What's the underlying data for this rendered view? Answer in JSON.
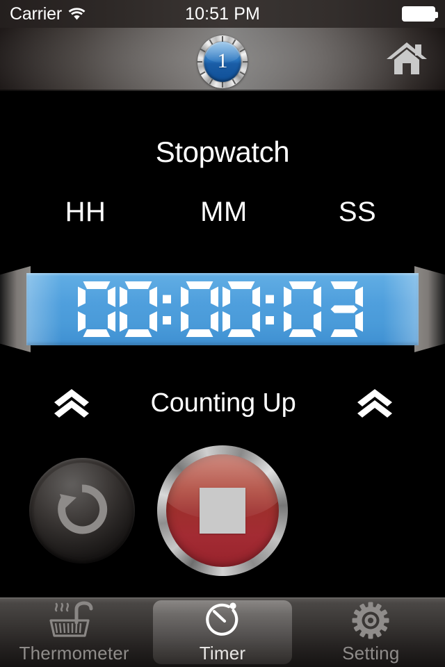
{
  "status_bar": {
    "carrier": "Carrier",
    "wifi_icon": "wifi-icon",
    "time": "10:51 PM",
    "battery_icon": "battery-full-icon"
  },
  "nav_bar": {
    "dial_button": {
      "icon": "dial-bezel-icon",
      "badge_number": "1"
    },
    "home_button": {
      "icon": "home-icon",
      "label": "Home"
    }
  },
  "main": {
    "title": "Stopwatch",
    "unit_labels": {
      "hours": "HH",
      "minutes": "MM",
      "seconds": "SS"
    },
    "display": {
      "value": "00:00:03",
      "hours": "00",
      "minutes": "00",
      "seconds": "03",
      "separator": ":",
      "panel_color": "#4a9bd9",
      "digit_color": "#ffffff"
    },
    "mode": {
      "label": "Counting Up",
      "left_icon": "chevron-double-up-icon",
      "right_icon": "chevron-double-up-icon"
    },
    "controls": {
      "reset": {
        "icon": "reset-rotate-ccw-icon",
        "label": "Reset"
      },
      "stop": {
        "icon": "stop-square-icon",
        "label": "Stop",
        "color": "#a32b33"
      }
    }
  },
  "tab_bar": {
    "tabs": [
      {
        "label": "Thermometer",
        "icon": "sauna-stove-icon",
        "active": false
      },
      {
        "label": "Timer",
        "icon": "stopwatch-icon",
        "active": true
      },
      {
        "label": "Setting",
        "icon": "gear-icon",
        "active": false
      }
    ]
  }
}
